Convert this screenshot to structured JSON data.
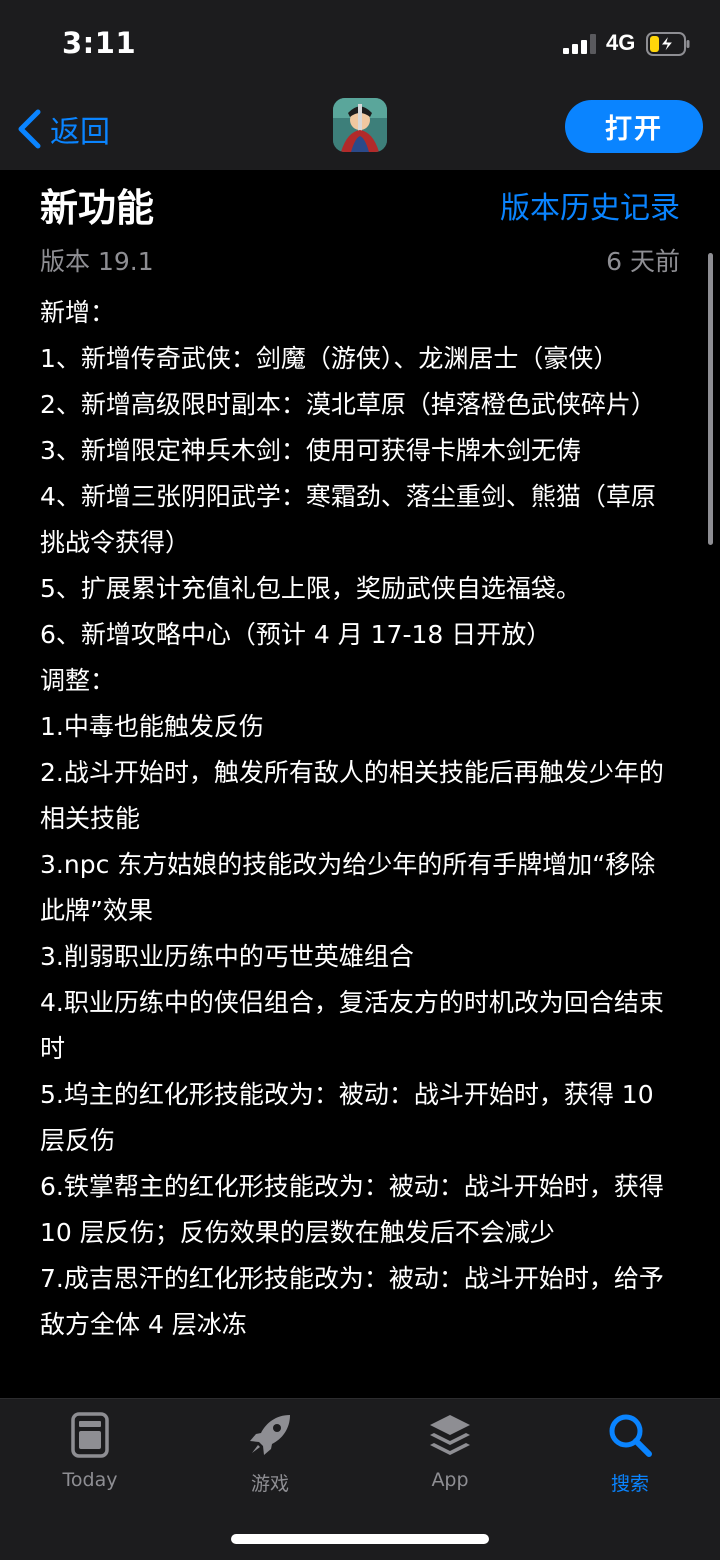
{
  "status_bar": {
    "time": "3:11",
    "network": "4G",
    "battery_color": "#ffd60a"
  },
  "nav": {
    "back_label": "返回",
    "open_label": "打开",
    "accent": "#0a84ff"
  },
  "whats_new": {
    "title": "新功能",
    "history_link": "版本历史记录",
    "version": "版本 19.1",
    "date": "6 天前",
    "notes": [
      "新增：",
      "1、新增传奇武侠：剑魔（游侠）、龙渊居士（豪侠）",
      "2、新增高级限时副本：漠北草原（掉落橙色武侠碎片）",
      "3、新增限定神兵木剑：使用可获得卡牌木剑无俦",
      "4、新增三张阴阳武学：寒霜劲、落尘重剑、熊猫（草原挑战令获得）",
      "5、扩展累计充值礼包上限，奖励武侠自选福袋。",
      "6、新增攻略中心（预计 4 月 17-18 日开放）",
      "调整：",
      "1.中毒也能触发反伤",
      "2.战斗开始时，触发所有敌人的相关技能后再触发少年的相关技能",
      "3.npc 东方姑娘的技能改为给少年的所有手牌增加“移除此牌”效果",
      "3.削弱职业历练中的丐世英雄组合",
      "4.职业历练中的侠侣组合，复活友方的时机改为回合结束时",
      "5.坞主的红化形技能改为：被动：战斗开始时，获得 10 层反伤",
      "6.铁掌帮主的红化形技能改为：被动：战斗开始时，获得 10 层反伤；反伤效果的层数在触发后不会减少",
      "7.成吉思汗的红化形技能改为：被动：战斗开始时，给予敌方全体 4 层冰冻"
    ]
  },
  "tabs": [
    {
      "label": "Today",
      "icon": "today-icon"
    },
    {
      "label": "游戏",
      "icon": "rocket-icon"
    },
    {
      "label": "App",
      "icon": "apps-stack-icon"
    },
    {
      "label": "搜索",
      "icon": "search-icon"
    }
  ]
}
